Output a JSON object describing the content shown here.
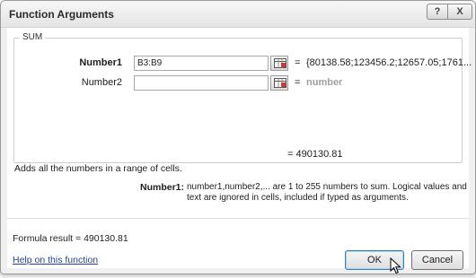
{
  "dialog": {
    "title": "Function Arguments",
    "help_glyph": "?",
    "close_glyph": "X"
  },
  "function_group": {
    "name": "SUM",
    "args": [
      {
        "label": "Number1",
        "value": "B3:B9",
        "equals": "=",
        "result": "{80138.58;123456.2;12657.05;1761..."
      },
      {
        "label": "Number2",
        "value": "",
        "equals": "=",
        "result": "number"
      }
    ]
  },
  "function_result": "= 490130.81",
  "description": "Adds all the numbers in a range of cells.",
  "arg_help": {
    "label": "Number1:",
    "text": "number1,number2,... are 1 to 255 numbers to sum. Logical values and text are ignored in cells, included if typed as arguments."
  },
  "formula_result": "Formula result =  490130.81",
  "help_link": "Help on this function",
  "buttons": {
    "ok": "OK",
    "cancel": "Cancel"
  },
  "icons": {
    "collapse": "range-collapse-icon",
    "cursor": "mouse-pointer-icon"
  }
}
